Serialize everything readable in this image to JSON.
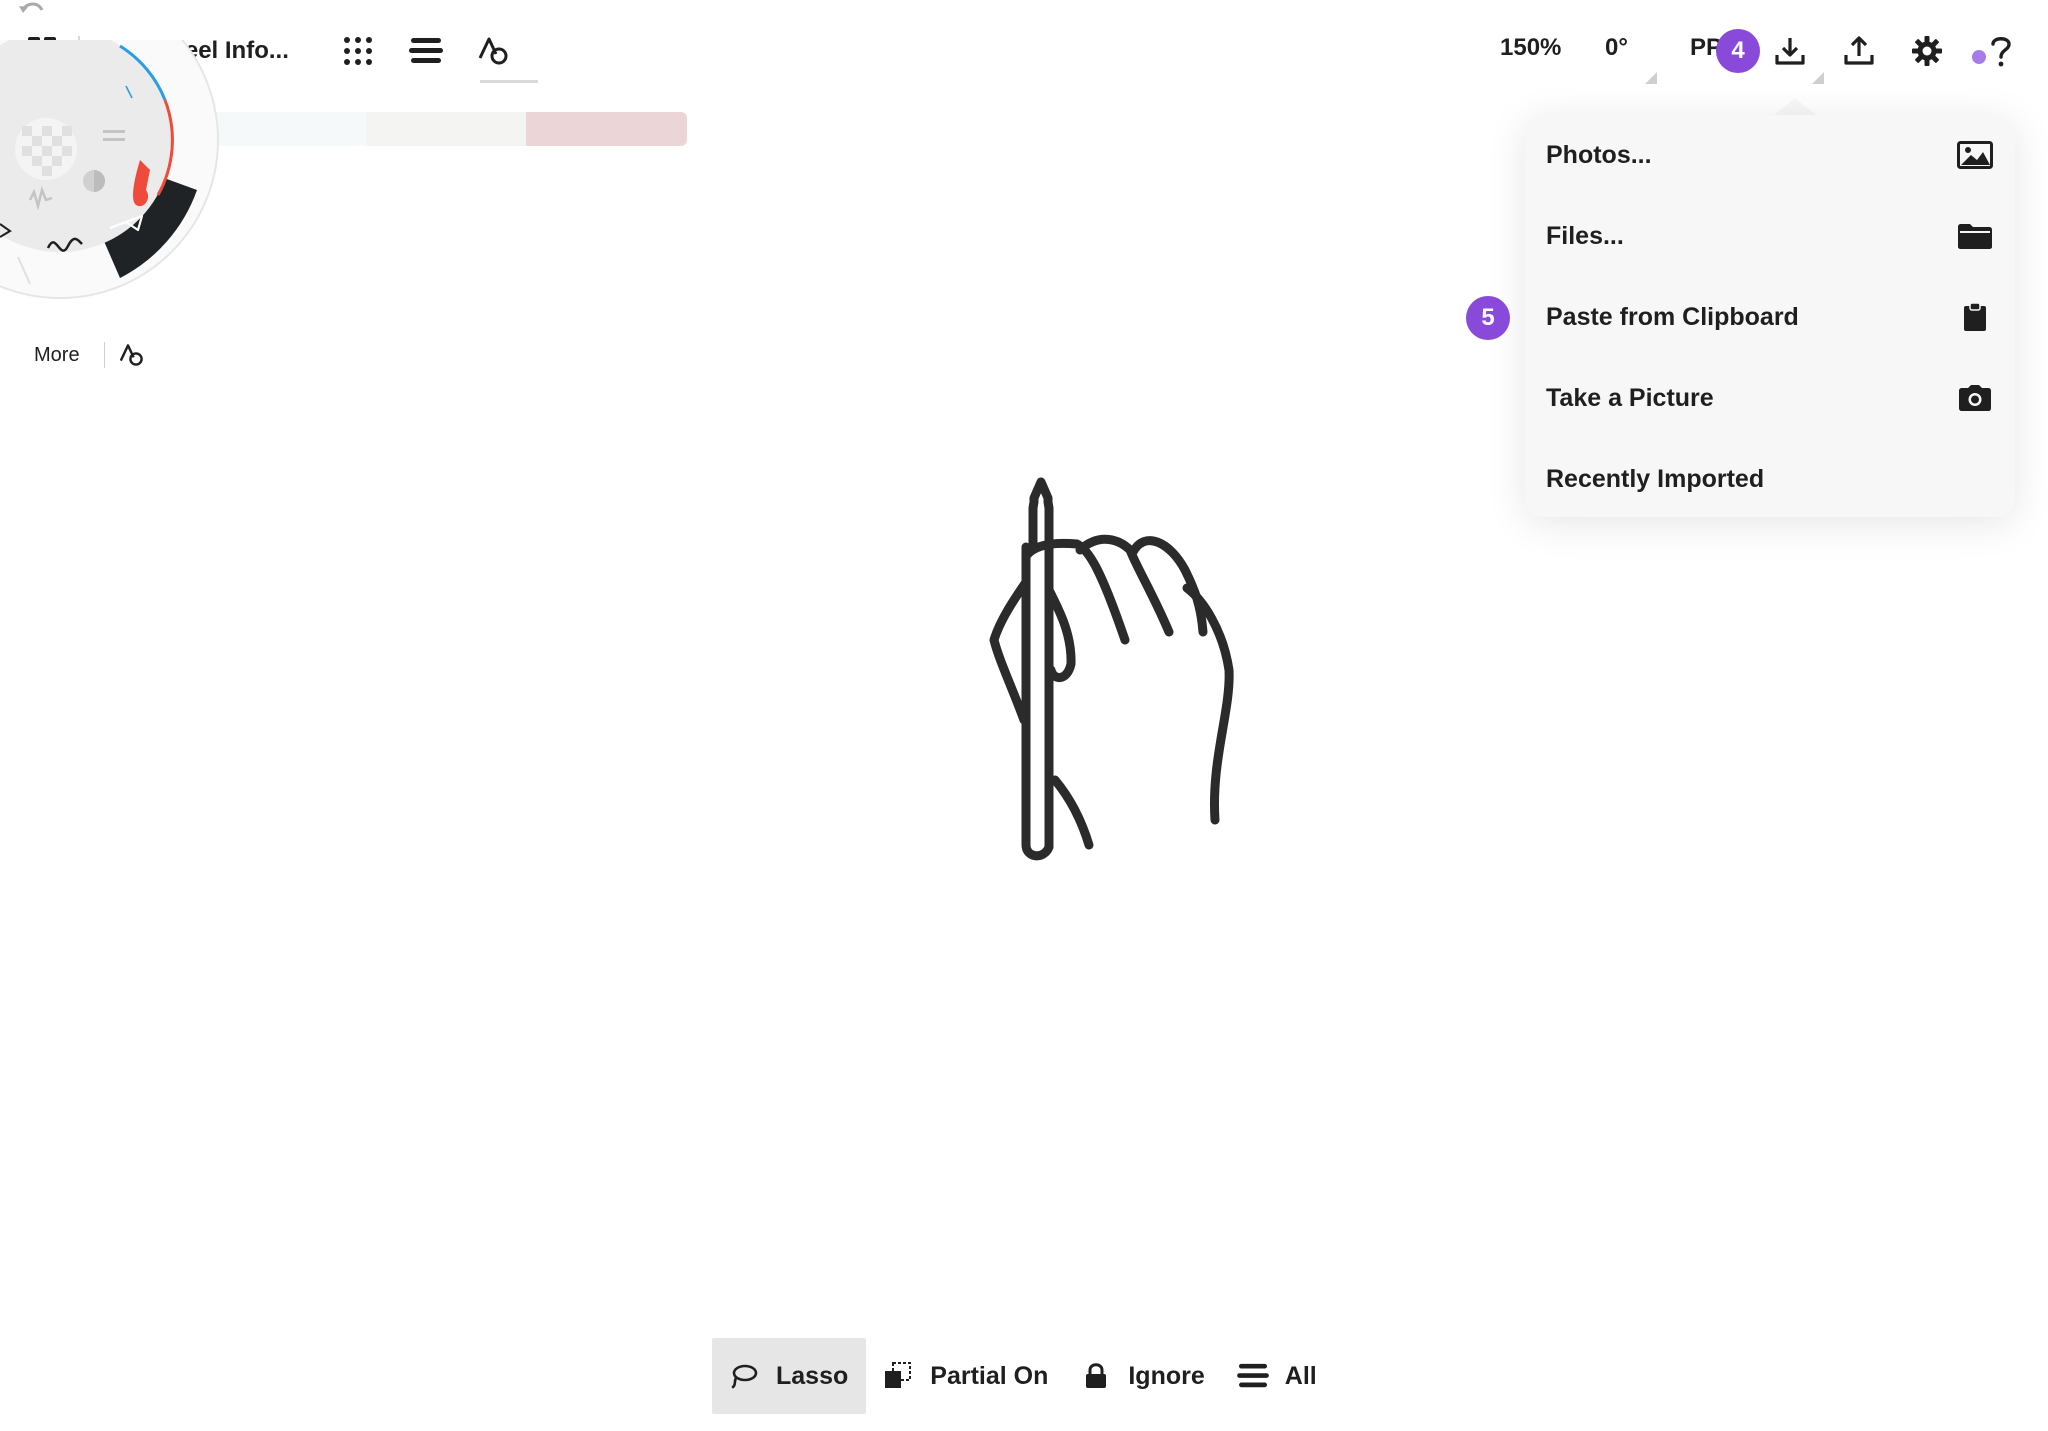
{
  "header": {
    "doc_title": "Tool Wheel Info...",
    "zoom": "150%",
    "rotation": "0°",
    "pp_label": "PP"
  },
  "badges": {
    "step4": "4",
    "step5": "5"
  },
  "import_menu": {
    "items": [
      {
        "label": "Photos...",
        "icon": "photo-icon"
      },
      {
        "label": "Files...",
        "icon": "folder-icon"
      },
      {
        "label": "Paste from Clipboard",
        "icon": "clipboard-icon"
      },
      {
        "label": "Take a Picture",
        "icon": "camera-icon"
      },
      {
        "label": "Recently Imported",
        "icon": ""
      }
    ]
  },
  "tool_wheel": {
    "more_label": "More"
  },
  "bottom_toolbar": {
    "lasso": "Lasso",
    "partial": "Partial On",
    "ignore": "Ignore",
    "all": "All"
  },
  "colors": {
    "accent_purple": "#8a4ad9",
    "wheel_dark": "#1f2326",
    "brush_red": "#ef4b3c",
    "swatch_1": "#f6f8f8",
    "swatch_2": "#f4f4f4",
    "swatch_3": "#ecd6d8"
  }
}
